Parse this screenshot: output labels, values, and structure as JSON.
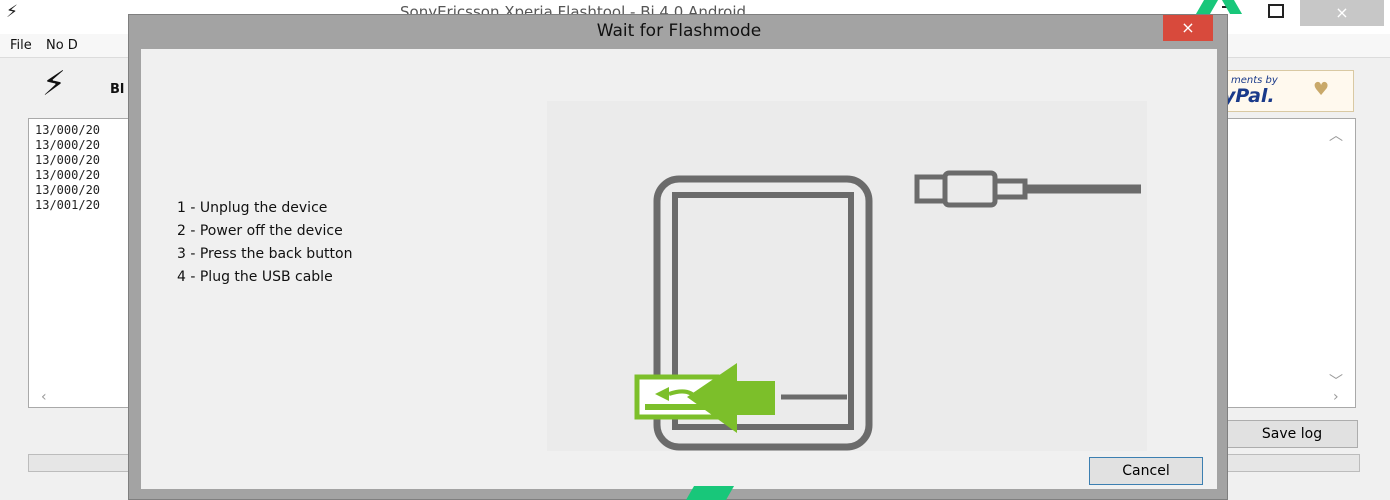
{
  "app": {
    "title": "SonyEricsson Xperia Flashtool - Bi 4.0 Android",
    "icon": "bolt-icon",
    "window_controls": {
      "minimize": "minimize-icon",
      "maximize": "maximize-icon",
      "close": "×"
    }
  },
  "menu": {
    "items": [
      "File",
      "No D"
    ]
  },
  "toolbar": {
    "label": "Bl",
    "icon": "bolt-icon"
  },
  "paypal": {
    "small_text": "ments by",
    "logo_text": "yPal.",
    "icon": "heart-icon"
  },
  "log": {
    "lines": [
      "13/000/20",
      "13/000/20",
      "13/000/20",
      "13/000/20",
      "13/000/20",
      "13/001/20"
    ]
  },
  "buttons": {
    "save_log": "Save log"
  },
  "dialog": {
    "title": "Wait for Flashmode",
    "close": "×",
    "steps": [
      "1 - Unplug the device",
      "2 - Power off the device",
      "3 - Press the back button",
      "4 - Plug the USB cable"
    ],
    "cancel": "Cancel"
  },
  "colors": {
    "accent_green": "#7cbf2a",
    "dialog_close_red": "#d84a3c",
    "watermark_green": "#18c77a",
    "phone_outline": "#6b6b6b"
  }
}
